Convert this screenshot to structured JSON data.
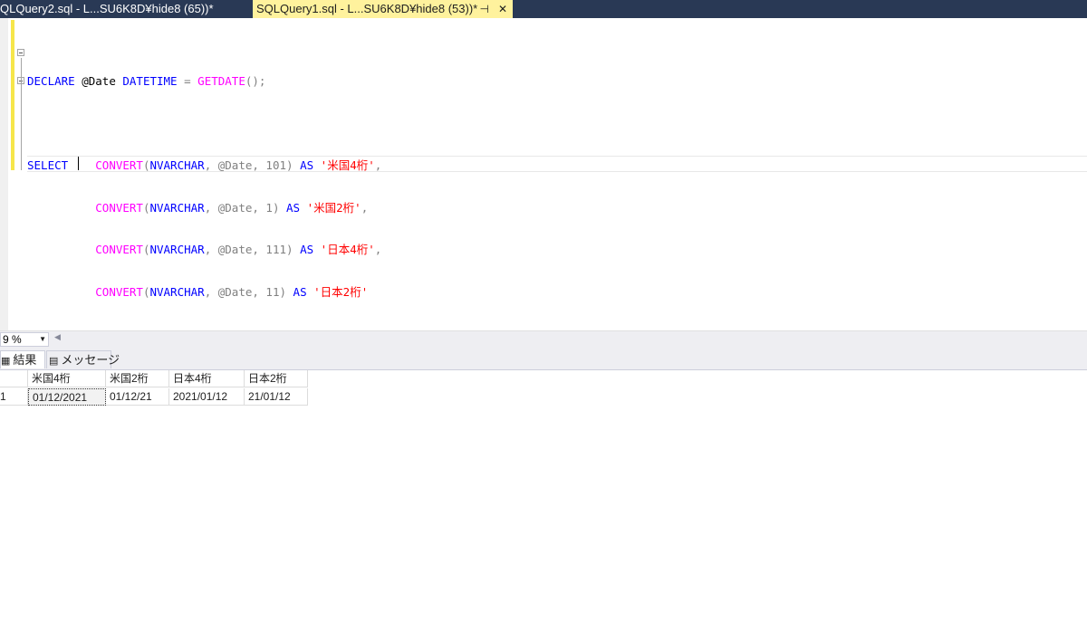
{
  "tabs": [
    {
      "label": "QLQuery2.sql - L...SU6K8D¥hide8 (65))*",
      "active": false
    },
    {
      "label": "SQLQuery1.sql - L...SU6K8D¥hide8 (53))*",
      "active": true
    }
  ],
  "icons": {
    "pin": "pin-icon",
    "close": "close-icon"
  },
  "editor": {
    "line1": {
      "kw1": "DECLARE",
      "var": " @Date ",
      "kw2": "DATETIME",
      "op": " = ",
      "fn": "GETDATE",
      "tail": "();"
    },
    "select_kw": "SELECT",
    "rows": [
      {
        "fn": "CONVERT",
        "p1": "(",
        "type": "NVARCHAR",
        "args": ", @Date, 101)",
        "as": "AS",
        "str": "'米国4桁'",
        "end": ","
      },
      {
        "fn": "CONVERT",
        "p1": "(",
        "type": "NVARCHAR",
        "args": ", @Date, 1)",
        "as": "AS",
        "str": "'米国2桁'",
        "end": ","
      },
      {
        "fn": "CONVERT",
        "p1": "(",
        "type": "NVARCHAR",
        "args": ", @Date, 111)",
        "as": "AS",
        "str": "'日本4桁'",
        "end": ","
      },
      {
        "fn": "CONVERT",
        "p1": "(",
        "type": "NVARCHAR",
        "args": ", @Date, 11)",
        "as": "AS",
        "str": "'日本2桁'",
        "end": ""
      }
    ]
  },
  "zoom": {
    "value": "9 %"
  },
  "result_tabs": {
    "results": "結果",
    "messages": "メッセージ"
  },
  "grid": {
    "headers": [
      "米国4桁",
      "米国2桁",
      "日本4桁",
      "日本2桁"
    ],
    "rows": [
      {
        "num": "1",
        "cells": [
          "01/12/2021",
          "01/12/21",
          "2021/01/12",
          "21/01/12"
        ]
      }
    ]
  },
  "colors": {
    "tabbar": "#293955",
    "active_tab": "#fff29d",
    "keyword": "#0000ff",
    "function": "#ff00ff",
    "string": "#ff0000"
  }
}
